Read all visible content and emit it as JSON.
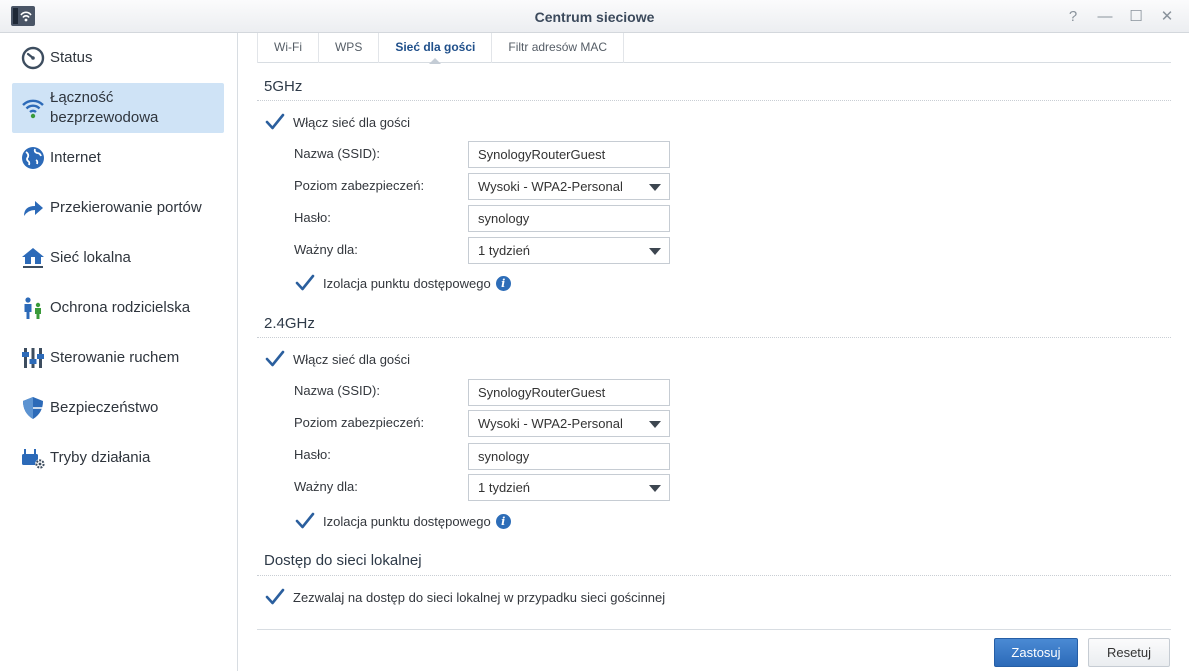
{
  "window": {
    "title": "Centrum sieciowe",
    "help_glyph": "?",
    "minimize_glyph": "—",
    "maximize_glyph": "☐",
    "close_glyph": "✕"
  },
  "sidebar": {
    "items": [
      {
        "label": "Status",
        "icon": "gauge-icon"
      },
      {
        "label": "Łączność\nbezprzewodowa",
        "icon": "wifi-icon",
        "active": true
      },
      {
        "label": "Internet",
        "icon": "globe-icon"
      },
      {
        "label": "Przekierowanie portów",
        "icon": "forward-arrow-icon"
      },
      {
        "label": "Sieć lokalna",
        "icon": "home-network-icon"
      },
      {
        "label": "Ochrona rodzicielska",
        "icon": "family-icon"
      },
      {
        "label": "Sterowanie ruchem",
        "icon": "sliders-icon"
      },
      {
        "label": "Bezpieczeństwo",
        "icon": "shield-icon"
      },
      {
        "label": "Tryby działania",
        "icon": "router-gear-icon"
      }
    ]
  },
  "tabs": [
    "Wi-Fi",
    "WPS",
    "Sieć dla gości",
    "Filtr adresów MAC"
  ],
  "active_tab": 2,
  "band_5ghz": {
    "title": "5GHz",
    "enable_label": "Włącz sieć dla gości",
    "ssid_label": "Nazwa (SSID):",
    "ssid_value": "SynologyRouterGuest",
    "security_label": "Poziom zabezpieczeń:",
    "security_value": "Wysoki - WPA2-Personal",
    "password_label": "Hasło:",
    "password_value": "synology",
    "valid_label": "Ważny dla:",
    "valid_value": "1 tydzień",
    "isolation_label": "Izolacja punktu dostępowego"
  },
  "band_24ghz": {
    "title": "2.4GHz",
    "enable_label": "Włącz sieć dla gości",
    "ssid_label": "Nazwa (SSID):",
    "ssid_value": "SynologyRouterGuest",
    "security_label": "Poziom zabezpieczeń:",
    "security_value": "Wysoki - WPA2-Personal",
    "password_label": "Hasło:",
    "password_value": "synology",
    "valid_label": "Ważny dla:",
    "valid_value": "1 tydzień",
    "isolation_label": "Izolacja punktu dostępowego"
  },
  "lan_access": {
    "title": "Dostęp do sieci lokalnej",
    "allow_label": "Zezwalaj na dostęp do sieci lokalnej w przypadku sieci gościnnej"
  },
  "buttons": {
    "apply": "Zastosuj",
    "reset": "Resetuj"
  },
  "colors": {
    "accent": "#2c6ab8",
    "active_nav_bg": "#cfe3f6",
    "check": "#2b5f9e"
  }
}
